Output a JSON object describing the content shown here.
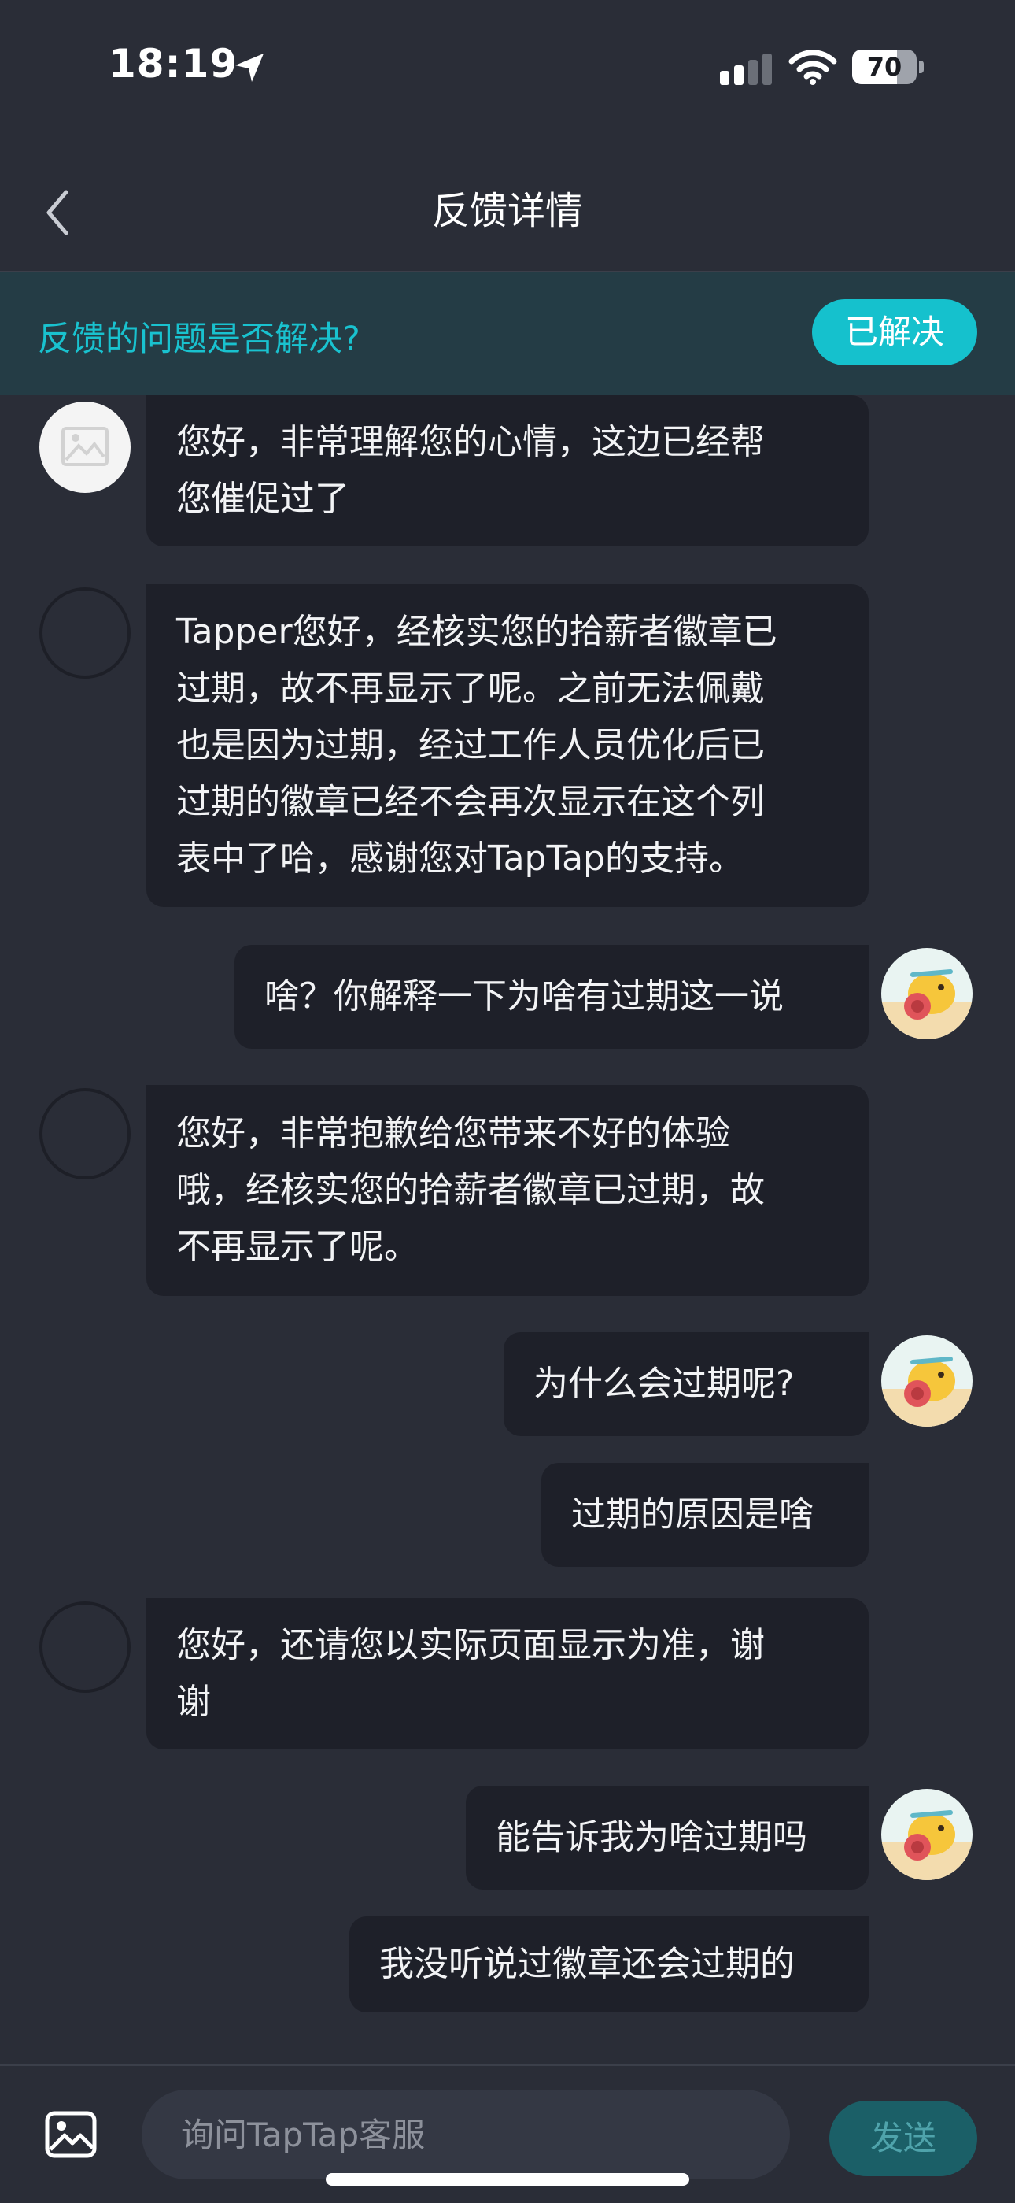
{
  "status_bar": {
    "time": "18:19",
    "battery": "70"
  },
  "nav": {
    "title": "反馈详情"
  },
  "banner": {
    "question": "反馈的问题是否解决?",
    "resolved_label": "已解决"
  },
  "messages": [
    {
      "side": "in",
      "avatar": "placeholder-image",
      "lines": [
        "您好，非常理解您的心情，这边已经帮",
        "您催促过了"
      ]
    },
    {
      "side": "in",
      "avatar": "empty",
      "lines": [
        "Tapper您好，经核实您的拾薪者徽章已",
        "过期，故不再显示了呢。之前无法佩戴",
        "也是因为过期，经过工作人员优化后已",
        "过期的徽章已经不会再次显示在这个列",
        "表中了哈，感谢您对TapTap的支持。"
      ]
    },
    {
      "side": "out",
      "avatar": "user",
      "lines": [
        "啥？你解释一下为啥有过期这一说"
      ]
    },
    {
      "side": "in",
      "avatar": "empty",
      "lines": [
        "您好，非常抱歉给您带来不好的体验",
        "哦，经核实您的拾薪者徽章已过期，故",
        "不再显示了呢。"
      ]
    },
    {
      "side": "out",
      "avatar": "user",
      "lines": [
        "为什么会过期呢?"
      ]
    },
    {
      "side": "out",
      "avatar": "none",
      "lines": [
        "过期的原因是啥"
      ]
    },
    {
      "side": "in",
      "avatar": "empty",
      "lines": [
        "您好，还请您以实际页面显示为准，谢",
        "谢"
      ]
    },
    {
      "side": "out",
      "avatar": "user",
      "lines": [
        "能告诉我为啥过期吗"
      ]
    },
    {
      "side": "out",
      "avatar": "none",
      "lines": [
        "我没听说过徽章还会过期的"
      ]
    }
  ],
  "input": {
    "placeholder": "询问TapTap客服",
    "send_label": "发送"
  },
  "colors": {
    "accent": "#15c1cd",
    "background": "#2a2d37",
    "bubble": "#1e2029",
    "banner": "#243c45"
  },
  "icons": {
    "back": "chevron-left-icon",
    "location": "location-arrow-icon",
    "wifi": "wifi-icon",
    "signal": "cellular-signal-icon",
    "image": "image-icon"
  }
}
